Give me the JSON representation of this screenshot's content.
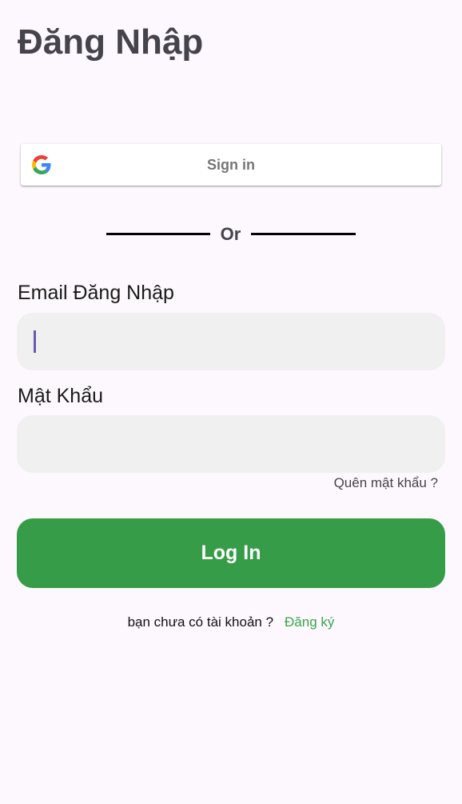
{
  "page": {
    "title": "Đăng Nhập"
  },
  "google_signin": {
    "label": "Sign in",
    "icon": "google-icon"
  },
  "divider": {
    "text": "Or"
  },
  "email": {
    "label": "Email Đăng Nhập",
    "value": "",
    "placeholder": ""
  },
  "password": {
    "label": "Mật Khẩu",
    "value": "",
    "placeholder": ""
  },
  "forgot_password": {
    "label": "Quên mật khẩu ?"
  },
  "login_button": {
    "label": "Log In"
  },
  "signup": {
    "prompt": "bạn chưa có tài khoản ?",
    "link": "Đăng ký"
  },
  "colors": {
    "background": "#fdf8fd",
    "primary_green": "#369c47",
    "link_green": "#3aa54b",
    "field_background": "#f0f0f0",
    "cursor": "#6a5aa8"
  }
}
